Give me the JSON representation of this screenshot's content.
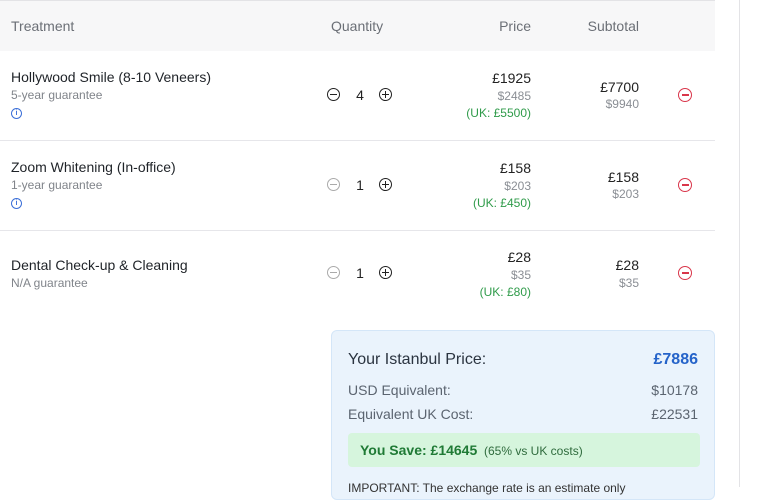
{
  "table": {
    "headers": {
      "treatment": "Treatment",
      "quantity": "Quantity",
      "price": "Price",
      "subtotal": "Subtotal"
    },
    "rows": [
      {
        "name": "Hollywood Smile (8-10 Veneers)",
        "guarantee": "5-year guarantee",
        "info_icon": "i",
        "quantity": "4",
        "price": "£1925",
        "price_usd": "$2485",
        "price_uk": "(UK: £5500)",
        "subtotal": "£7700",
        "subtotal_usd": "$9940"
      },
      {
        "name": "Zoom Whitening (In-office)",
        "guarantee": "1-year guarantee",
        "info_icon": "i",
        "quantity": "1",
        "price": "£158",
        "price_usd": "$203",
        "price_uk": "(UK: £450)",
        "subtotal": "£158",
        "subtotal_usd": "$203"
      },
      {
        "name": "Dental Check-up & Cleaning",
        "guarantee": "N/A guarantee",
        "quantity": "1",
        "price": "£28",
        "price_usd": "$35",
        "price_uk": "(UK: £80)",
        "subtotal": "£28",
        "subtotal_usd": "$35"
      }
    ]
  },
  "summary": {
    "title": "Your Istanbul Price:",
    "total": "£7886",
    "usd_label": "USD Equivalent:",
    "usd_value": "$10178",
    "uk_label": "Equivalent UK Cost:",
    "uk_value": "£22531",
    "save_main": "You Save: £14645",
    "save_sub": "(65% vs UK costs)",
    "important": "IMPORTANT: The exchange rate is an estimate only"
  },
  "colors": {
    "accent": "#2563c9",
    "remove": "#d9364a",
    "uk_green": "#2f9b4a",
    "summary_bg": "#eaf3fc",
    "save_bg": "#d6f5dd"
  }
}
